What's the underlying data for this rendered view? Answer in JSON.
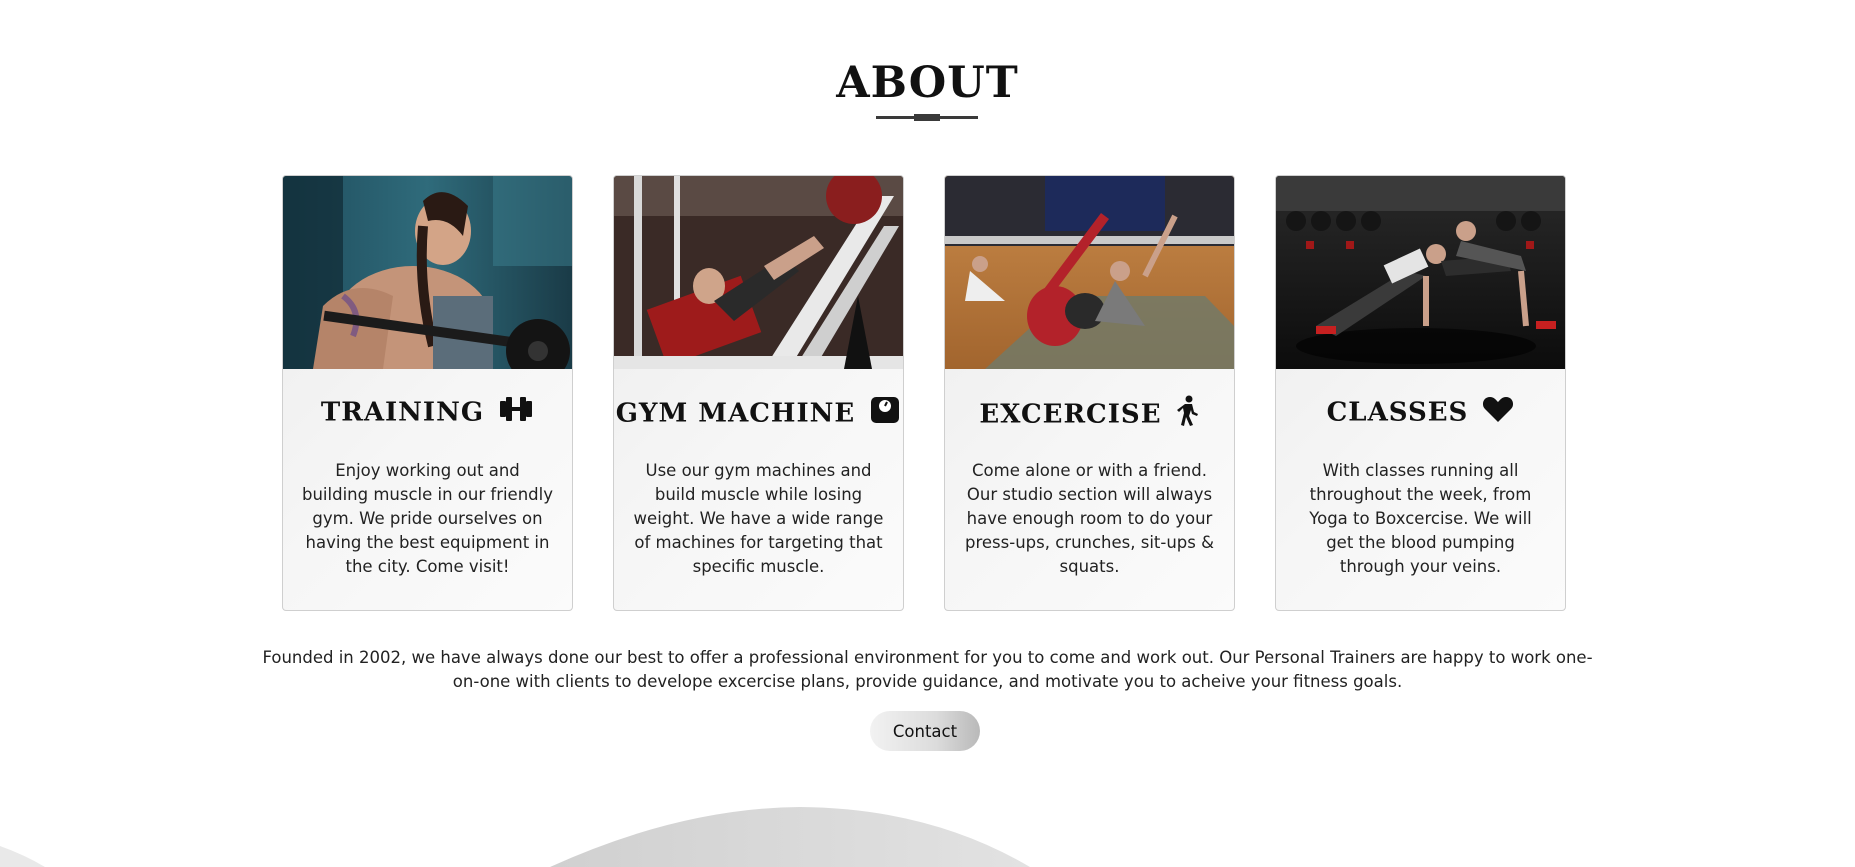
{
  "about": {
    "title": "ABOUT"
  },
  "cards": [
    {
      "title": "TRAINING",
      "icon": "dumbbell-icon",
      "text": "Enjoy working out and building muscle in our friendly gym. We pride ourselves on having the best equipment in the city. Come visit!",
      "image": "woman-training-photo"
    },
    {
      "title": "GYM MACHINE",
      "icon": "weight-scale-icon",
      "text": "Use our gym machines and build muscle while losing weight. We have a wide range of machines for targeting that specific muscle.",
      "image": "leg-press-machine-photo"
    },
    {
      "title": "EXCERCISE",
      "icon": "person-walking-icon",
      "text": "Come alone or with a friend. Our studio section will always have enough room to do your press-ups, crunches, sit-ups & squats.",
      "image": "group-stretching-photo"
    },
    {
      "title": "CLASSES",
      "icon": "heart-icon",
      "text": "With classes running all throughout the week, from Yoga to Boxcercise. We will get the blood pumping through your veins.",
      "image": "pushup-class-photo"
    }
  ],
  "founded": {
    "text": "Founded in 2002, we have always done our best to offer a professional environment for you to come and work out. Our Personal Trainers are happy to work one-on-one with clients to develope excercise plans, provide guidance, and motivate you to acheive your fitness goals."
  },
  "contact": {
    "label": "Contact"
  }
}
